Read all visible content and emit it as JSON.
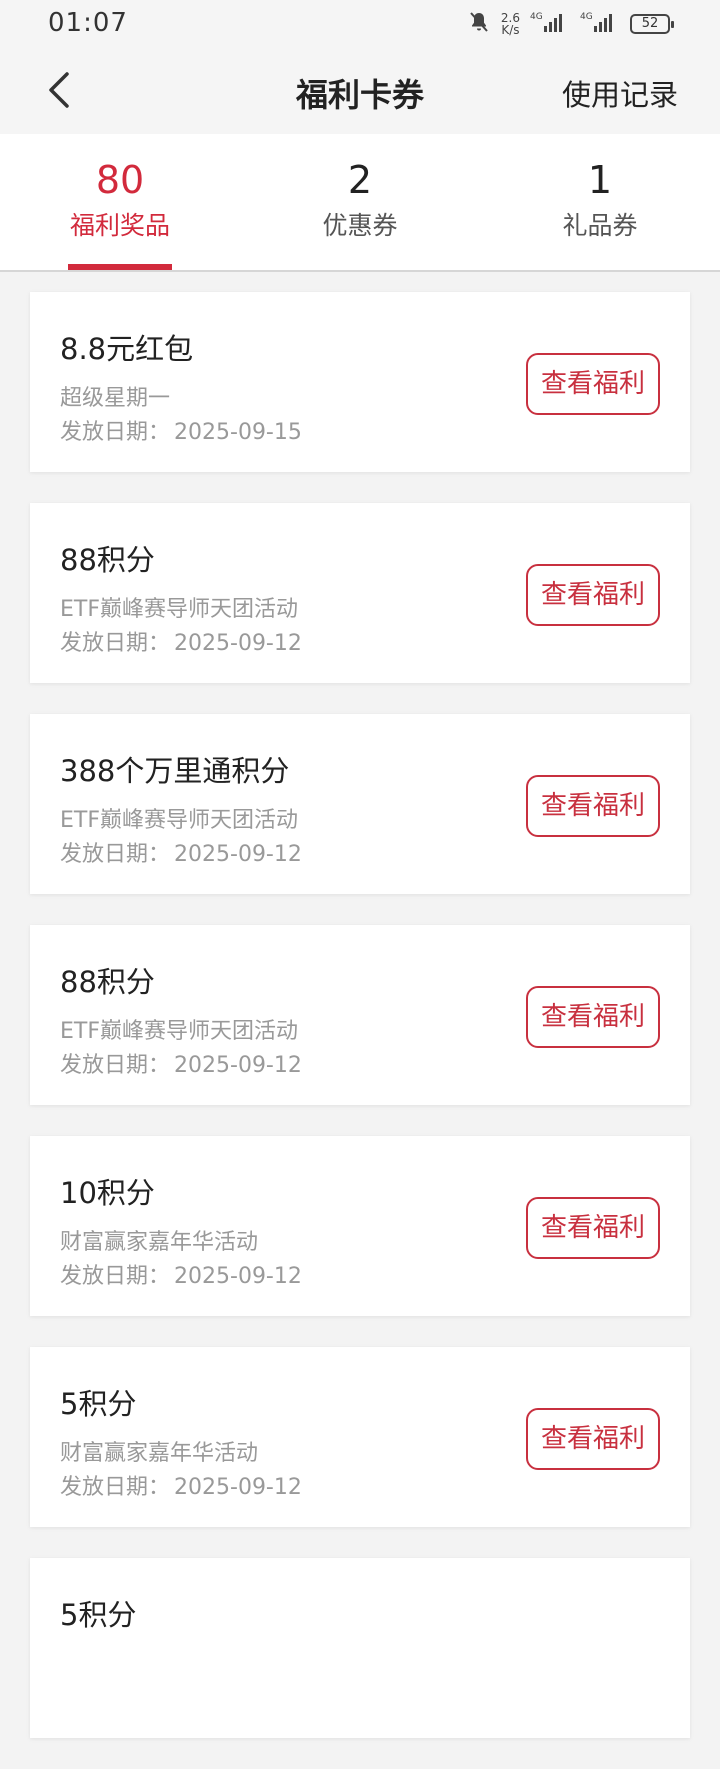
{
  "status_bar": {
    "time": "01:07",
    "speed_value": "2.6",
    "speed_unit": "K/s",
    "network_1": "4G",
    "network_2": "4G",
    "battery": "52"
  },
  "header": {
    "title": "福利卡券",
    "history_label": "使用记录"
  },
  "tabs": [
    {
      "count": "80",
      "label": "福利奖品",
      "active": true
    },
    {
      "count": "2",
      "label": "优惠券",
      "active": false
    },
    {
      "count": "1",
      "label": "礼品券",
      "active": false
    }
  ],
  "date_prefix": "发放日期：",
  "view_button_label": "查看福利",
  "colors": {
    "accent": "#d22a3c"
  },
  "items": [
    {
      "title": "8.8元红包",
      "source": "超级星期一",
      "date": "2025-09-15"
    },
    {
      "title": "88积分",
      "source": "ETF巅峰赛导师天团活动",
      "date": "2025-09-12"
    },
    {
      "title": "388个万里通积分",
      "source": "ETF巅峰赛导师天团活动",
      "date": "2025-09-12"
    },
    {
      "title": "88积分",
      "source": "ETF巅峰赛导师天团活动",
      "date": "2025-09-12"
    },
    {
      "title": "10积分",
      "source": "财富赢家嘉年华活动",
      "date": "2025-09-12"
    },
    {
      "title": "5积分",
      "source": "财富赢家嘉年华活动",
      "date": "2025-09-12"
    },
    {
      "title": "5积分",
      "source": "",
      "date": ""
    }
  ]
}
